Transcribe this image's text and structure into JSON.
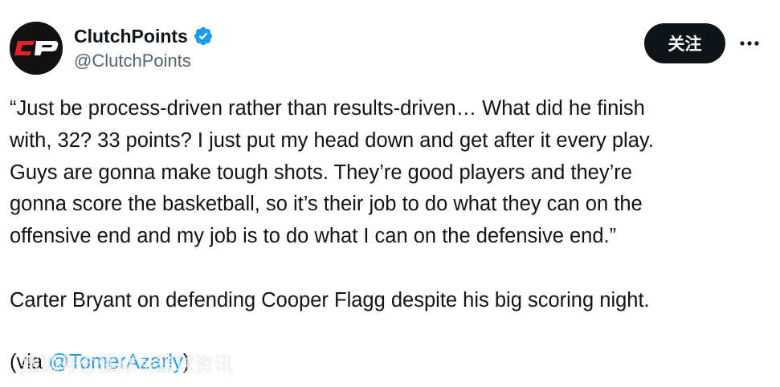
{
  "author": {
    "display_name": "ClutchPoints",
    "handle": "@ClutchPoints",
    "avatar_icon": "clutchpoints-cp-logo",
    "avatar_text": "CP",
    "verified_icon": "verified-badge-icon",
    "verified_color": "#1d9bf0"
  },
  "actions": {
    "follow_label": "关注",
    "more_icon": "more-horizontal-icon"
  },
  "tweet": {
    "quote_lines": [
      "“Just be process-driven rather than results-driven… What did he finish",
      "with, 32? 33 points? I just put my head down and get after it every play.",
      "Guys are gonna make tough shots. They’re good players and they’re",
      "gonna score the basketball, so it’s their job to do what they can on the",
      "offensive end and my job is to do what I can on the defensive end.”"
    ],
    "context": "Carter Bryant on defending Cooper Flagg despite his big scoring night.",
    "credit_prefix": "(via ",
    "credit_mention": "@TomerAzarly",
    "credit_suffix": ")"
  },
  "watermark": {
    "text": "搜狐号@懂球帝篮球资讯"
  },
  "colors": {
    "text": "#0f1419",
    "secondary": "#536471",
    "link": "#1d9bf0",
    "button_bg": "#0f1419",
    "logo_red": "#e0202a"
  }
}
